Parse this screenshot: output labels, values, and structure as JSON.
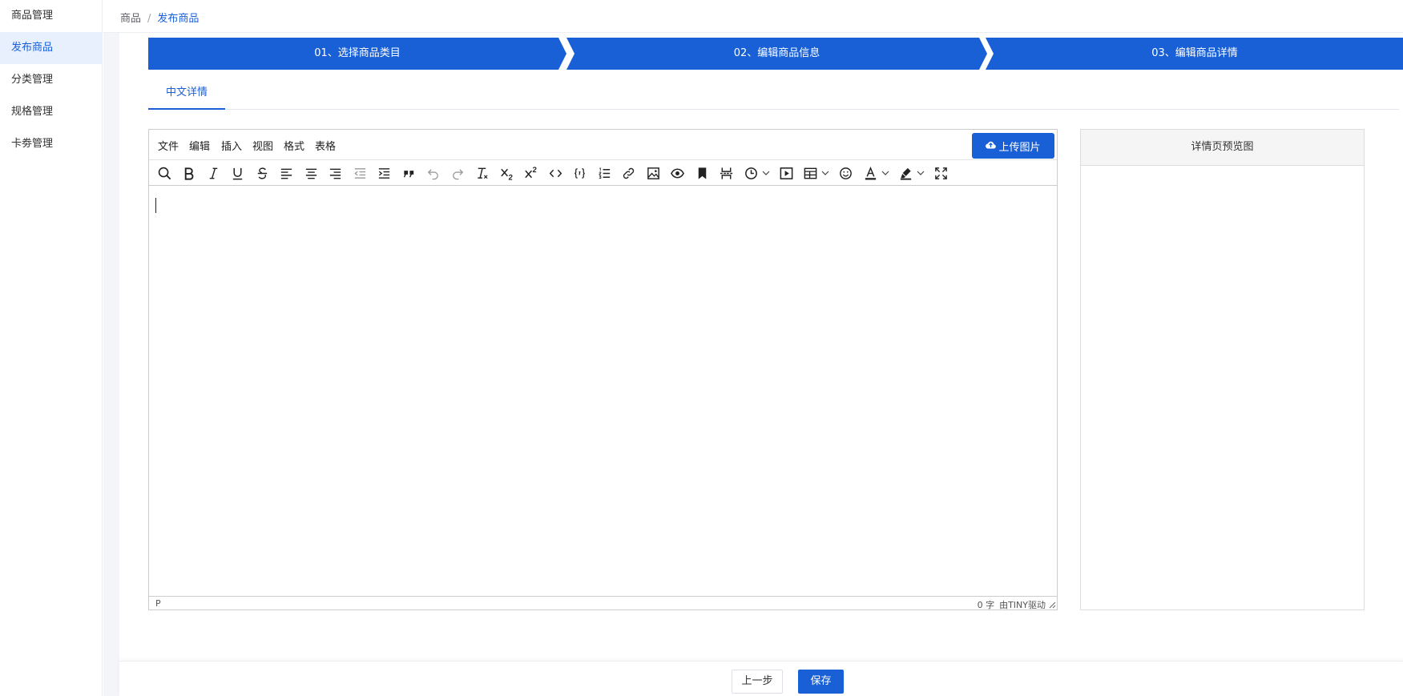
{
  "sidebar": {
    "items": [
      {
        "label": "商品管理",
        "active": false
      },
      {
        "label": "发布商品",
        "active": true
      },
      {
        "label": "分类管理",
        "active": false
      },
      {
        "label": "规格管理",
        "active": false
      },
      {
        "label": "卡劵管理",
        "active": false
      }
    ]
  },
  "breadcrumb": {
    "parent": "商品",
    "separator": "/",
    "current": "发布商品"
  },
  "steps": [
    "01、选择商品类目",
    "02、编辑商品信息",
    "03、编辑商品详情"
  ],
  "tabs": {
    "active_label": "中文详情"
  },
  "editor": {
    "menu": [
      "文件",
      "编辑",
      "插入",
      "视图",
      "格式",
      "表格"
    ],
    "upload_button": "上传图片",
    "toolbar": [
      "search-replace",
      "bold",
      "italic",
      "underline",
      "strikethrough",
      "align-left",
      "align-center",
      "align-right",
      "outdent",
      "indent",
      "blockquote",
      "undo",
      "redo",
      "remove-format",
      "subscript",
      "superscript",
      "code",
      "code-sample",
      "numbered-list",
      "link",
      "image",
      "preview",
      "anchor",
      "page-break",
      "insert-datetime",
      "media",
      "table",
      "emoticons",
      "text-color",
      "highlight-color",
      "fullscreen"
    ],
    "status_path": "P",
    "word_count": "0 字",
    "powered_by": "由TINY驱动"
  },
  "preview": {
    "title": "详情页预览图"
  },
  "footer": {
    "prev_label": "上一步",
    "save_label": "保存"
  },
  "colors": {
    "primary": "#195fd6",
    "sidebar_active_bg": "#e8effd"
  }
}
